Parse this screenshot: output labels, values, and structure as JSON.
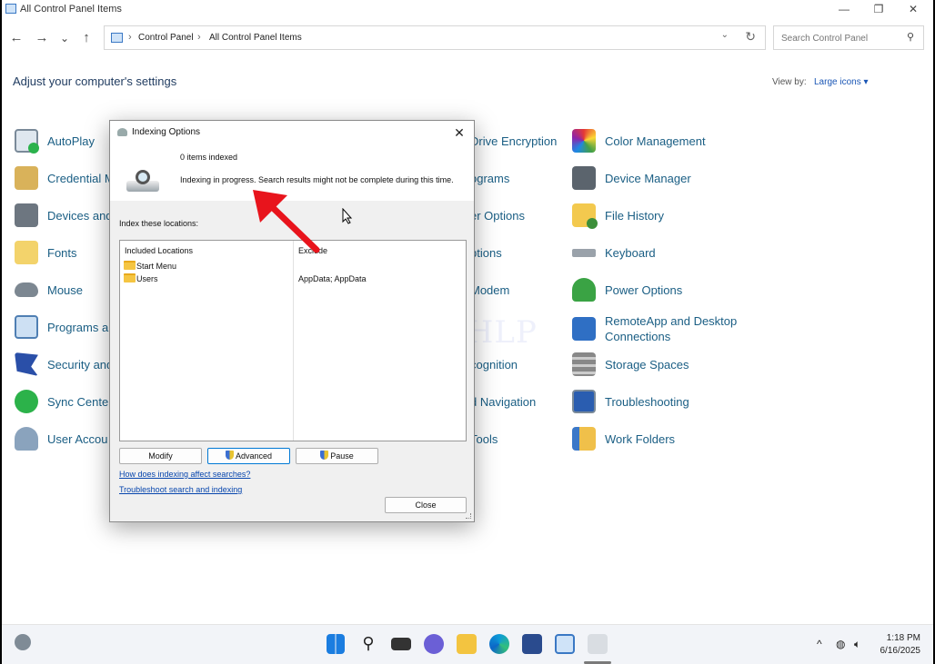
{
  "window": {
    "title": "All Control Panel Items",
    "minimize_glyph": "—",
    "maximize_glyph": "❐",
    "close_glyph": "✕"
  },
  "nav": {
    "back_glyph": "←",
    "forward_glyph": "→",
    "recent_glyph": "⌄",
    "up_glyph": "↑"
  },
  "address": {
    "crumbs": [
      "Control Panel",
      "All Control Panel Items"
    ],
    "separator": "›"
  },
  "search": {
    "placeholder": "Search Control Panel"
  },
  "header": {
    "title": "Adjust your computer's settings",
    "view_by_label": "View by:",
    "view_by_value": "Large icons ▾"
  },
  "items": {
    "col1": [
      "AutoPlay",
      "Credential M",
      "Devices and",
      "Fonts",
      "Mouse",
      "Programs ar",
      "Security and",
      "Sync Center",
      "User Accou"
    ],
    "col3": [
      "Drive Encryption",
      "ograms",
      "er Options",
      "ptions",
      "Modem",
      "",
      "cognition",
      "d Navigation",
      "Tools"
    ],
    "col4": [
      "Color Management",
      "Device Manager",
      "File History",
      "Keyboard",
      "Power Options",
      "RemoteApp and Desktop Connections",
      "Storage Spaces",
      "Troubleshooting",
      "Work Folders"
    ]
  },
  "dialog": {
    "title": "Indexing Options",
    "items_indexed": "0 items indexed",
    "status": "Indexing in progress. Search results might not be complete during this time.",
    "index_label": "Index these locations:",
    "col_included": "Included Locations",
    "col_exclude": "Exclude",
    "locations": [
      {
        "name": "Start Menu",
        "exclude": ""
      },
      {
        "name": "Users",
        "exclude": "AppData; AppData"
      }
    ],
    "modify": "Modify",
    "advanced": "Advanced",
    "pause": "Pause",
    "link1": "How does indexing affect searches?",
    "link2": "Troubleshoot search and indexing",
    "close": "Close"
  },
  "watermark": "IT Pros HLP",
  "taskbar": {
    "time": "1:18 PM",
    "date": "6/16/2025",
    "tray_chevron": "^"
  },
  "colors": {
    "link": "#1a5e84",
    "accent": "#0078d4",
    "arrow": "#e8141c"
  }
}
